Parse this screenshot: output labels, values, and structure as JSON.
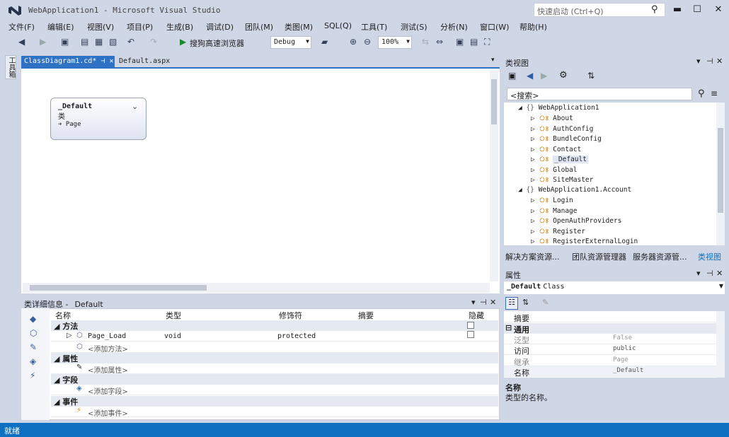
{
  "window": {
    "title": "WebApplication1 - Microsoft Visual Studio",
    "quick_launch_placeholder": "快速启动 (Ctrl+Q)",
    "minimize": "▬",
    "maximize": "☐",
    "close": "✕"
  },
  "menu": [
    "文件(F)",
    "编辑(E)",
    "视图(V)",
    "项目(P)",
    "生成(B)",
    "调试(D)",
    "团队(M)",
    "类图(M)",
    "SQL(Q)",
    "工具(T)",
    "测试(S)",
    "分析(N)",
    "窗口(W)",
    "帮助(H)"
  ],
  "toolbar": {
    "run_label": "搜狗高速浏览器",
    "config": "Debug",
    "zoom": "100%"
  },
  "toolbox_tab": "工具箱",
  "doc_tabs": {
    "active": "ClassDiagram1.cd*",
    "other": "Default.aspx"
  },
  "diagram": {
    "class_name": "_Default",
    "class_kind": "类",
    "base": "Page"
  },
  "class_details": {
    "title": "类详细信息 - _Default",
    "columns": [
      "名称",
      "类型",
      "修饰符",
      "摘要",
      "隐藏"
    ],
    "groups": {
      "methods": "方法",
      "properties": "属性",
      "fields": "字段",
      "events": "事件"
    },
    "method_row": {
      "name": "Page_Load",
      "type": "void",
      "modifier": "protected"
    },
    "add_method": "<添加方法>",
    "add_property": "<添加属性>",
    "add_field": "<添加字段>",
    "add_event": "<添加事件>"
  },
  "class_view": {
    "title": "类视图",
    "search_placeholder": "<搜索>",
    "namespaces": [
      {
        "name": "WebApplication1",
        "items": [
          "About",
          "AuthConfig",
          "BundleConfig",
          "Contact",
          "_Default",
          "Global",
          "SiteMaster"
        ]
      },
      {
        "name": "WebApplication1.Account",
        "items": [
          "Login",
          "Manage",
          "OpenAuthProviders",
          "Register",
          "RegisterExternalLogin"
        ]
      }
    ],
    "selected": "_Default",
    "tabs": [
      "解决方案资源...",
      "团队资源管理器",
      "服务器资源管...",
      "类视图"
    ]
  },
  "properties": {
    "title": "属性",
    "object": "_Default",
    "object_type": "Class",
    "rows": [
      {
        "key": "摘要",
        "value": ""
      },
      {
        "key": "通用",
        "value": "",
        "category": true
      },
      {
        "key": "泛型",
        "value": "False"
      },
      {
        "key": "访问",
        "value": "public"
      },
      {
        "key": "继承",
        "value": "Page"
      },
      {
        "key": "名称",
        "value": "_Default"
      }
    ],
    "desc_title": "名称",
    "desc_text": "类型的名称。"
  },
  "status": "就绪"
}
